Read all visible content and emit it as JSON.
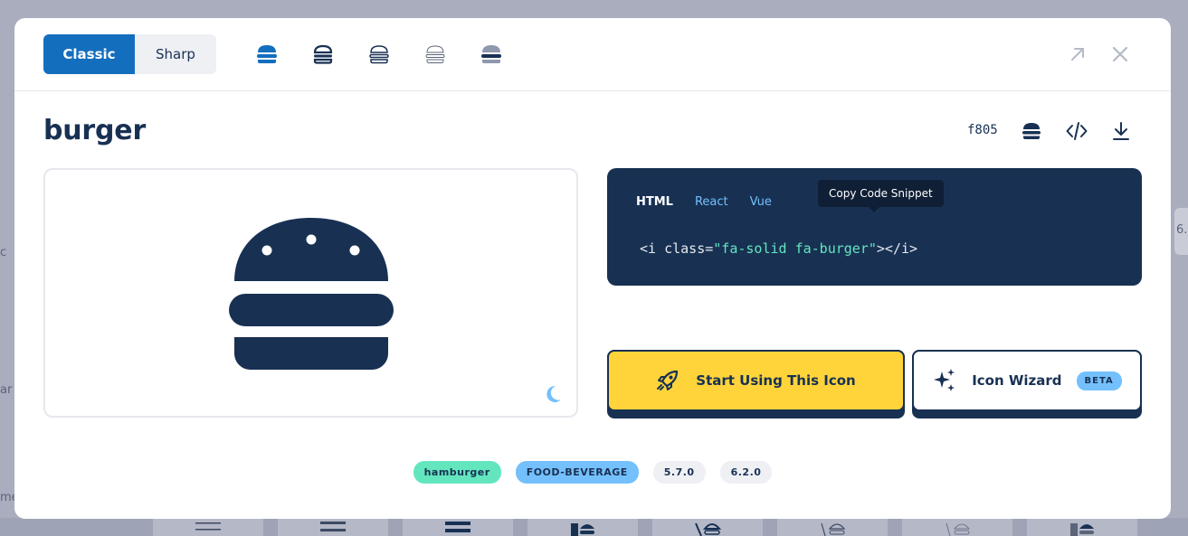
{
  "background": {
    "fragments": [
      "c",
      "ar",
      "me",
      "6."
    ]
  },
  "modal": {
    "family_toggle": {
      "active": "Classic",
      "inactive": "Sharp"
    },
    "style_icons": [
      "burger-solid-icon",
      "burger-regular-icon",
      "burger-light-icon",
      "burger-thin-icon",
      "burger-duotone-icon"
    ],
    "header_buttons": [
      "open-page-icon",
      "close-icon"
    ],
    "icon_name": "burger",
    "unicode": "f805",
    "actions": [
      "copy-glyph-icon",
      "code-icon",
      "download-icon"
    ],
    "code": {
      "tabs": [
        "HTML",
        "React",
        "Vue"
      ],
      "active_tab": "HTML",
      "tooltip": "Copy Code Snippet",
      "line_prefix": "<i class=",
      "line_value": "\"fa-solid fa-burger\"",
      "line_suffix": "></i>"
    },
    "buttons": {
      "start_label": "Start Using This Icon",
      "wizard_label": "Icon Wizard",
      "wizard_badge": "BETA"
    },
    "tags": [
      "hamburger",
      "FOOD-BEVERAGE",
      "5.7.0",
      "6.2.0"
    ]
  },
  "colors": {
    "primary": "#146ebe",
    "navy": "#183153",
    "yellow": "#ffd43b",
    "teal": "#63e6be",
    "light_blue": "#74c0fc"
  }
}
